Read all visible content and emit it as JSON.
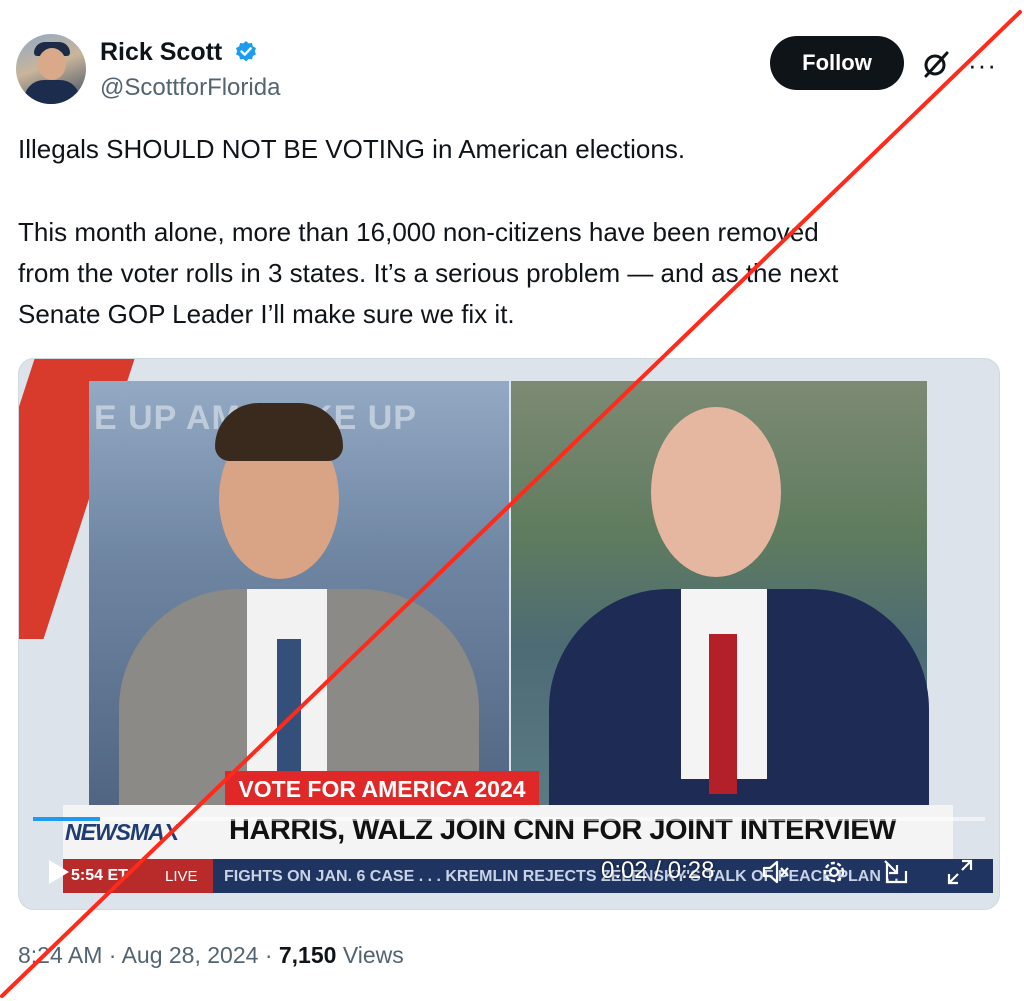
{
  "author": {
    "name": "Rick Scott",
    "handle": "@ScottforFlorida",
    "verified": true
  },
  "actions": {
    "follow_label": "Follow",
    "grok_icon": "grok-icon",
    "more_icon": "more-icon"
  },
  "tweet": {
    "line1": "Illegals SHOULD NOT BE VOTING in American elections.",
    "line2": "This month alone, more than 16,000 non-citizens have been removed",
    "line3": "from the voter rolls in 3 states. It’s a serious problem — and as the next",
    "line4": "Senate GOP Leader I’ll make sure we fix it."
  },
  "video": {
    "overlay_wakeup": "E UP AM   WAKE UP",
    "vote_banner": "VOTE FOR AMERICA 2024",
    "network": "NEWSMAX",
    "headline": "HARRIS, WALZ JOIN CNN FOR JOINT INTERVIEW",
    "ticker_time": "5:54 ET",
    "ticker_live": "LIVE",
    "ticker_text": "FIGHTS ON JAN. 6 CASE . . .     KREMLIN REJECTS ZELENSKY'S TALK OF PEACE PLAN . .",
    "time_display": "0:02 / 0:28",
    "progress": 0.07
  },
  "meta": {
    "time": "8:24 AM",
    "date": "Aug 28, 2024",
    "sep": "·",
    "views_count": "7,150",
    "views_label": "Views"
  },
  "colors": {
    "slash": "#ff2a1a",
    "follow_bg": "#0f1419",
    "verified": "#1d9bf0"
  }
}
